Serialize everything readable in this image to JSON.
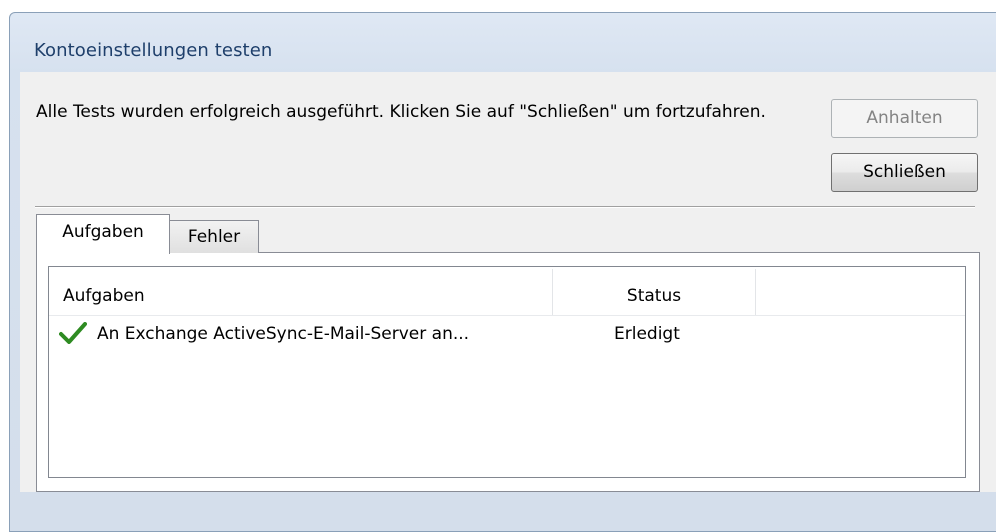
{
  "dialog": {
    "title": "Kontoeinstellungen testen",
    "message": "Alle Tests wurden erfolgreich ausgeführt. Klicken Sie auf \"Schließen\" um fortzufahren.",
    "stop_button": "Anhalten",
    "close_button": "Schließen"
  },
  "tabs": [
    {
      "label": "Aufgaben",
      "selected": true
    },
    {
      "label": "Fehler",
      "selected": false
    }
  ],
  "table": {
    "columns": [
      "Aufgaben",
      "Status"
    ],
    "rows": [
      {
        "icon": "checkmark-icon",
        "task": "An Exchange ActiveSync-E-Mail-Server an...",
        "status": "Erledigt"
      }
    ]
  },
  "colors": {
    "check": "#2e8b22",
    "title_text": "#1e3f6b"
  }
}
